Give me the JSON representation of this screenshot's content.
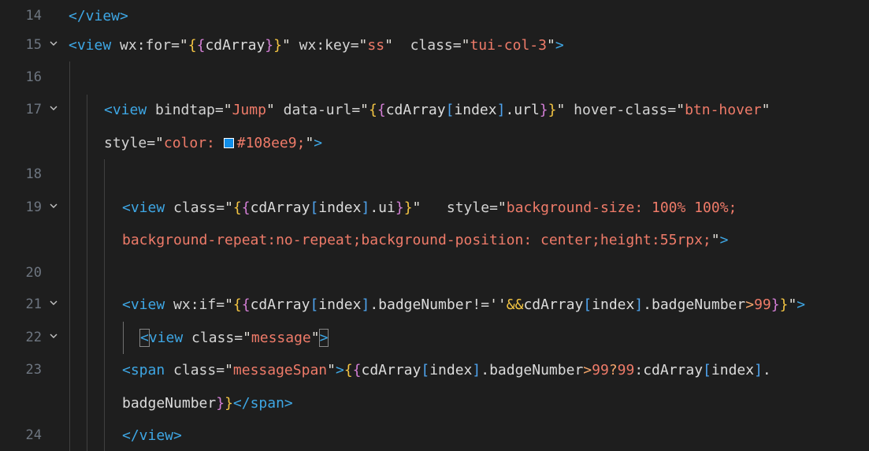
{
  "editor": {
    "line_numbers": [
      "14",
      "15",
      "16",
      "17",
      "",
      "18",
      "19",
      "",
      "20",
      "21",
      "22",
      "23",
      "",
      "24"
    ],
    "swatch_color": "#108ee9",
    "fold_icon": "chevron-down-icon"
  },
  "lines": [
    {
      "num": "14",
      "tokens": [
        [
          "t-tag",
          "</view>"
        ]
      ]
    },
    {
      "num": "15",
      "tokens": [
        [
          "t-tag",
          "<view "
        ],
        [
          "t-attr",
          "wx:for"
        ],
        [
          "t-eq",
          "="
        ],
        [
          "t-q",
          "\""
        ],
        [
          "t-b1",
          "{"
        ],
        [
          "t-b2",
          "{"
        ],
        [
          "t-var",
          "cdArray"
        ],
        [
          "t-b2",
          "}"
        ],
        [
          "t-b1",
          "}"
        ],
        [
          "t-q",
          "\""
        ],
        [
          "t-attr",
          " wx:key"
        ],
        [
          "t-eq",
          "="
        ],
        [
          "t-q",
          "\""
        ],
        [
          "t-str",
          "ss"
        ],
        [
          "t-q",
          "\""
        ],
        [
          "t-attr",
          "  class"
        ],
        [
          "t-eq",
          "="
        ],
        [
          "t-q",
          "\""
        ],
        [
          "t-str",
          "tui-col-3"
        ],
        [
          "t-q",
          "\""
        ],
        [
          "t-tag",
          ">"
        ]
      ]
    },
    {
      "num": "16",
      "tokens": []
    },
    {
      "num": "17",
      "tokens": [
        [
          "t-tag",
          "<view "
        ],
        [
          "t-attr",
          "bindtap"
        ],
        [
          "t-eq",
          "="
        ],
        [
          "t-q",
          "\""
        ],
        [
          "t-str",
          "Jump"
        ],
        [
          "t-q",
          "\""
        ],
        [
          "t-attr",
          " data-url"
        ],
        [
          "t-eq",
          "="
        ],
        [
          "t-q",
          "\""
        ],
        [
          "t-b1",
          "{"
        ],
        [
          "t-b2",
          "{"
        ],
        [
          "t-var",
          "cdArray"
        ],
        [
          "t-b3",
          "["
        ],
        [
          "t-var",
          "index"
        ],
        [
          "t-b3",
          "]"
        ],
        [
          "t-var",
          ".url"
        ],
        [
          "t-b2",
          "}"
        ],
        [
          "t-b1",
          "}"
        ],
        [
          "t-q",
          "\""
        ],
        [
          "t-attr",
          " hover-class"
        ],
        [
          "t-eq",
          "="
        ],
        [
          "t-q",
          "\""
        ],
        [
          "t-str",
          "btn-hover"
        ],
        [
          "t-q",
          "\""
        ]
      ]
    },
    {
      "num": "",
      "tokens": [
        [
          "t-attr",
          "style"
        ],
        [
          "t-eq",
          "="
        ],
        [
          "t-q",
          "\""
        ],
        [
          "t-str",
          "color: "
        ],
        [
          "swatch",
          ""
        ],
        [
          "t-str",
          "#108ee9;"
        ],
        [
          "t-q",
          "\""
        ],
        [
          "t-tag",
          ">"
        ]
      ]
    },
    {
      "num": "18",
      "tokens": []
    },
    {
      "num": "19",
      "tokens": [
        [
          "t-tag",
          "<view "
        ],
        [
          "t-attr",
          "class"
        ],
        [
          "t-eq",
          "="
        ],
        [
          "t-q",
          "\""
        ],
        [
          "t-b1",
          "{"
        ],
        [
          "t-b2",
          "{"
        ],
        [
          "t-var",
          "cdArray"
        ],
        [
          "t-b3",
          "["
        ],
        [
          "t-var",
          "index"
        ],
        [
          "t-b3",
          "]"
        ],
        [
          "t-var",
          ".ui"
        ],
        [
          "t-b2",
          "}"
        ],
        [
          "t-b1",
          "}"
        ],
        [
          "t-q",
          "\""
        ],
        [
          "t-attr",
          "   style"
        ],
        [
          "t-eq",
          "="
        ],
        [
          "t-q",
          "\""
        ],
        [
          "t-str",
          "background-size: 100% 100%;"
        ]
      ]
    },
    {
      "num": "",
      "tokens": [
        [
          "t-str",
          "background-repeat:no-repeat;background-position: center;height:55rpx;"
        ],
        [
          "t-q",
          "\""
        ],
        [
          "t-tag",
          ">"
        ]
      ]
    },
    {
      "num": "20",
      "tokens": []
    },
    {
      "num": "21",
      "tokens": [
        [
          "t-tag",
          "<view "
        ],
        [
          "t-attr",
          "wx:if"
        ],
        [
          "t-eq",
          "="
        ],
        [
          "t-q",
          "\""
        ],
        [
          "t-b1",
          "{"
        ],
        [
          "t-b2",
          "{"
        ],
        [
          "t-var",
          "cdArray"
        ],
        [
          "t-b3",
          "["
        ],
        [
          "t-var",
          "index"
        ],
        [
          "t-b3",
          "]"
        ],
        [
          "t-var",
          ".badgeNumber"
        ],
        [
          "t-op",
          "!="
        ],
        [
          "t-q",
          "''"
        ],
        [
          "t-b1",
          "&&"
        ],
        [
          "t-var",
          "cdArray"
        ],
        [
          "t-b3",
          "["
        ],
        [
          "t-var",
          "index"
        ],
        [
          "t-b3",
          "]"
        ],
        [
          "t-var",
          ".badgeNumber"
        ],
        [
          "t-gt",
          ">"
        ],
        [
          "t-num",
          "99"
        ],
        [
          "t-b2",
          "}"
        ],
        [
          "t-b1",
          "}"
        ],
        [
          "t-q",
          "\""
        ],
        [
          "t-tag",
          ">"
        ]
      ]
    },
    {
      "num": "22",
      "tokens": [
        [
          "box-open",
          "<"
        ],
        [
          "t-tag",
          "view "
        ],
        [
          "t-attr",
          "class"
        ],
        [
          "t-eq",
          "="
        ],
        [
          "t-q",
          "\""
        ],
        [
          "t-str",
          "message"
        ],
        [
          "t-q",
          "\""
        ],
        [
          "box-close",
          ">"
        ]
      ]
    },
    {
      "num": "23",
      "tokens": [
        [
          "t-tag",
          "<span "
        ],
        [
          "t-attr",
          "class"
        ],
        [
          "t-eq",
          "="
        ],
        [
          "t-q",
          "\""
        ],
        [
          "t-str",
          "messageSpan"
        ],
        [
          "t-q",
          "\""
        ],
        [
          "t-tag",
          ">"
        ],
        [
          "t-b1",
          "{"
        ],
        [
          "t-b2",
          "{"
        ],
        [
          "t-var",
          "cdArray"
        ],
        [
          "t-b3",
          "["
        ],
        [
          "t-var",
          "index"
        ],
        [
          "t-b3",
          "]"
        ],
        [
          "t-var",
          ".badgeNumber"
        ],
        [
          "t-gt",
          ">"
        ],
        [
          "t-num",
          "99"
        ],
        [
          "t-gt",
          "?"
        ],
        [
          "t-num",
          "99"
        ],
        [
          "t-op",
          ":"
        ],
        [
          "t-var",
          "cdArray"
        ],
        [
          "t-b3",
          "["
        ],
        [
          "t-var",
          "index"
        ],
        [
          "t-b3",
          "]"
        ],
        [
          "t-var",
          "."
        ]
      ]
    },
    {
      "num": "",
      "tokens": [
        [
          "t-var",
          "badgeNumber"
        ],
        [
          "t-b2",
          "}"
        ],
        [
          "t-b1",
          "}"
        ],
        [
          "t-tag",
          "</span>"
        ]
      ]
    },
    {
      "num": "24",
      "tokens": [
        [
          "t-tag",
          "</view>"
        ]
      ]
    }
  ]
}
